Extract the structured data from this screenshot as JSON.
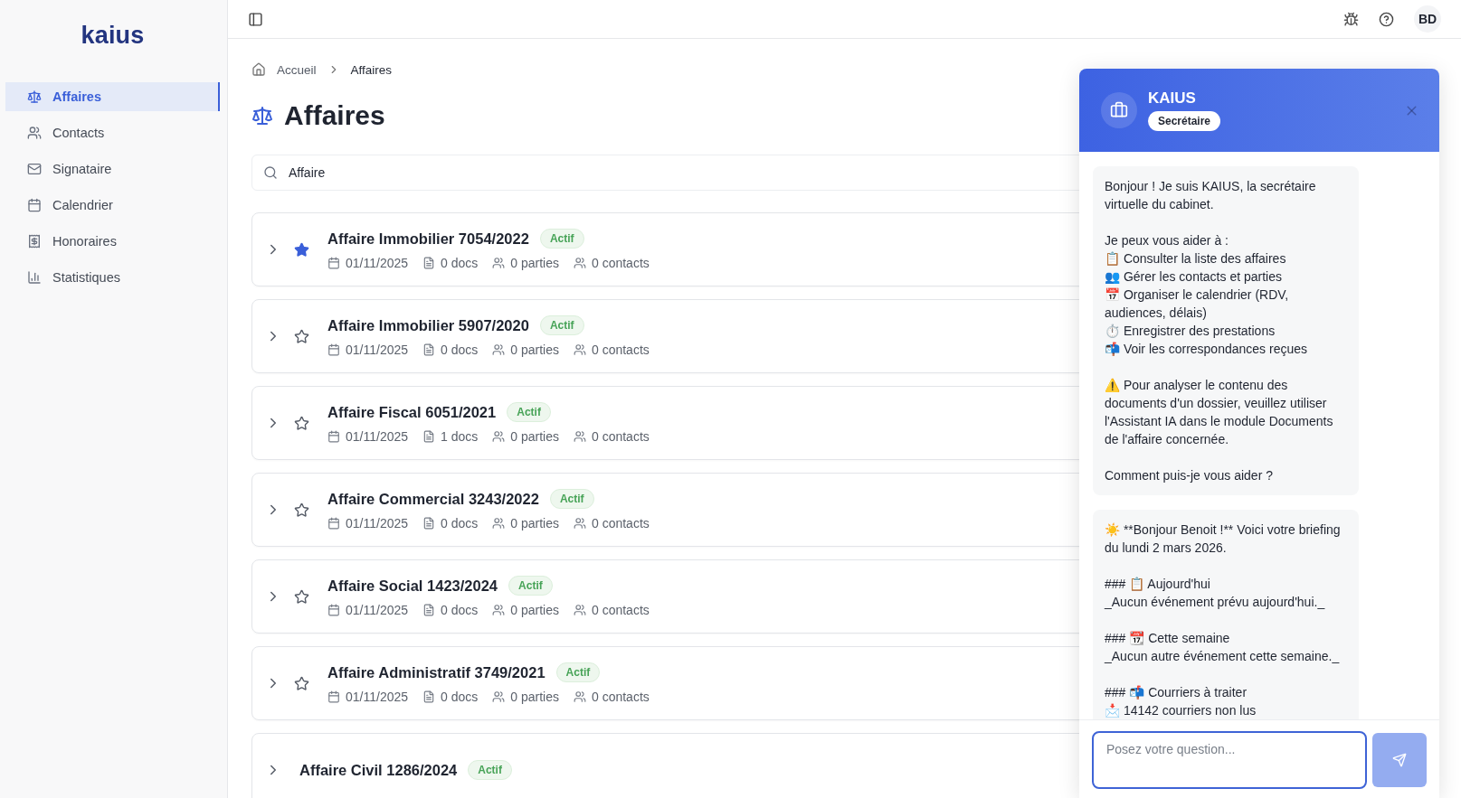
{
  "sidebar": {
    "logo": "kaius",
    "items": [
      {
        "label": "Affaires",
        "kind": "scale",
        "selected": true
      },
      {
        "label": "Contacts",
        "kind": "users",
        "selected": false
      },
      {
        "label": "Signataire",
        "kind": "mail",
        "selected": false
      },
      {
        "label": "Calendrier",
        "kind": "calendar",
        "selected": false
      },
      {
        "label": "Honoraires",
        "kind": "receipt",
        "selected": false
      },
      {
        "label": "Statistiques",
        "kind": "chart",
        "selected": false
      }
    ]
  },
  "topbar": {
    "avatar": "BD"
  },
  "breadcrumb": [
    "Accueil",
    "Affaires"
  ],
  "page": {
    "title": "Affaires"
  },
  "search": {
    "value": "Affaire"
  },
  "cases": [
    {
      "title": "Affaire Immobilier 7054/2022",
      "status": "Actif",
      "starred": true,
      "date": "01/11/2025",
      "docs": "0 docs",
      "parties": "0 parties",
      "contacts": "0 contacts"
    },
    {
      "title": "Affaire Immobilier 5907/2020",
      "status": "Actif",
      "starred": false,
      "date": "01/11/2025",
      "docs": "0 docs",
      "parties": "0 parties",
      "contacts": "0 contacts"
    },
    {
      "title": "Affaire Fiscal 6051/2021",
      "status": "Actif",
      "starred": false,
      "date": "01/11/2025",
      "docs": "1 docs",
      "parties": "0 parties",
      "contacts": "0 contacts"
    },
    {
      "title": "Affaire Commercial 3243/2022",
      "status": "Actif",
      "starred": false,
      "date": "01/11/2025",
      "docs": "0 docs",
      "parties": "0 parties",
      "contacts": "0 contacts"
    },
    {
      "title": "Affaire Social 1423/2024",
      "status": "Actif",
      "starred": false,
      "date": "01/11/2025",
      "docs": "0 docs",
      "parties": "0 parties",
      "contacts": "0 contacts"
    },
    {
      "title": "Affaire Administratif 3749/2021",
      "status": "Actif",
      "starred": false,
      "date": "01/11/2025",
      "docs": "0 docs",
      "parties": "0 parties",
      "contacts": "0 contacts"
    },
    {
      "title": "Affaire Civil 1286/2024",
      "status": "Actif"
    }
  ],
  "chat": {
    "name": "KAIUS",
    "role": "Secrétaire",
    "messages": [
      {
        "text": "Bonjour ! Je suis KAIUS, la secrétaire virtuelle du cabinet.\n\nJe peux vous aider à :\n📋 Consulter la liste des affaires\n👥 Gérer les contacts et parties\n📅 Organiser le calendrier (RDV, audiences, délais)\n⏱️ Enregistrer des prestations\n📬 Voir les correspondances reçues\n\n⚠️ Pour analyser le contenu des documents d'un dossier, veuillez utiliser l'Assistant IA dans le module Documents de l'affaire concernée.\n\nComment puis-je vous aider ?"
      },
      {
        "text": "☀️ **Bonjour Benoit !** Voici votre briefing du lundi 2 mars 2026.\n\n### 📋 Aujourd'hui\n_Aucun événement prévu aujourd'hui._\n\n### 📆 Cette semaine\n_Aucun autre événement cette semaine._\n\n### 📬 Courriers à traiter\n📩 14142 courriers non lus"
      }
    ],
    "input": {
      "placeholder": "Posez votre question..."
    }
  }
}
